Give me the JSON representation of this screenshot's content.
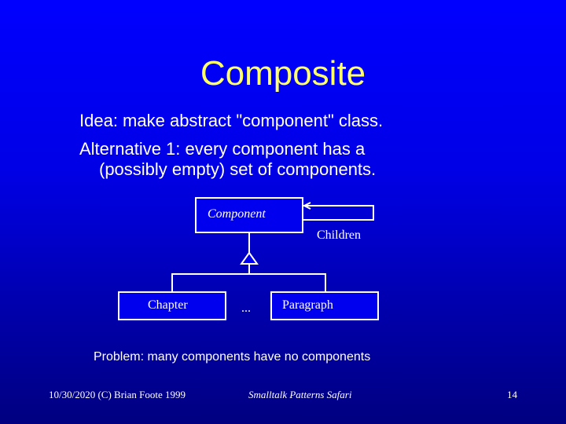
{
  "slide": {
    "title": "Composite",
    "bullets": [
      {
        "text": "Idea: make abstract \"component\" class."
      },
      {
        "text": "Alternative 1:  every component has a",
        "continuation": "(possibly empty) set of components."
      }
    ],
    "colors": {
      "title": "#ffff66",
      "text": "#ffffff",
      "background_top": "#0000ff",
      "background_bottom": "#000080",
      "box_fill": "#0000ee"
    }
  },
  "diagram": {
    "superclass": {
      "label": "Component"
    },
    "association": {
      "label": "Children"
    },
    "subclasses": [
      {
        "label": "Chapter"
      },
      {
        "label": "Paragraph"
      }
    ],
    "ellipsis": "..."
  },
  "problem": "Problem:  many components have no components",
  "footer": {
    "left": "10/30/2020 (C) Brian Foote 1999",
    "center": "Smalltalk Patterns Safari",
    "page_number": "14"
  }
}
